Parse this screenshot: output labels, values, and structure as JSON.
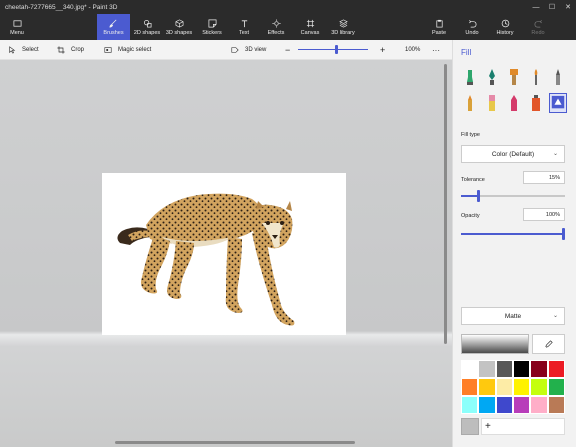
{
  "window": {
    "title": "cheetah-7277665__340.jpg* - Paint 3D",
    "minimize_glyph": "—",
    "maximize_glyph": "☐",
    "close_glyph": "✕"
  },
  "ribbon": {
    "menu": {
      "label": "Menu",
      "icon": "folder-icon"
    },
    "tools": [
      {
        "label": "Brushes",
        "icon": "brush-icon"
      },
      {
        "label": "2D shapes",
        "icon": "2d-shapes-icon"
      },
      {
        "label": "3D shapes",
        "icon": "3d-shapes-icon"
      },
      {
        "label": "Stickers",
        "icon": "stickers-icon"
      },
      {
        "label": "Text",
        "icon": "text-icon"
      },
      {
        "label": "Effects",
        "icon": "effects-icon"
      },
      {
        "label": "Canvas",
        "icon": "canvas-icon"
      },
      {
        "label": "3D library",
        "icon": "3d-library-icon"
      }
    ],
    "actions": [
      {
        "label": "Paste",
        "icon": "paste-icon"
      },
      {
        "label": "Undo",
        "icon": "undo-icon"
      },
      {
        "label": "History",
        "icon": "history-icon"
      },
      {
        "label": "Redo",
        "icon": "redo-icon"
      }
    ],
    "active_color": "#4b5bd0"
  },
  "toolbar": {
    "select": "Select",
    "crop": "Crop",
    "magic_select": "Magic select",
    "view_3d": "3D view",
    "zoom_out": "−",
    "zoom_in": "+",
    "zoom_value": "100%",
    "zoom_level": 0.53,
    "more": "···"
  },
  "panel": {
    "title": "Fill",
    "brushes": [
      "marker-icon",
      "calligraphy-pen-icon",
      "oil-brush-icon",
      "watercolor-icon",
      "pixel-pen-icon",
      "pencil-icon",
      "eraser-icon",
      "crayon-icon",
      "spray-can-icon",
      "fill-icon"
    ],
    "fill_type_label": "Fill type",
    "fill_type_value": "Color (Default)",
    "tolerance_label": "Tolerance",
    "tolerance_value": "15%",
    "tolerance_level": 0.15,
    "opacity_label": "Opacity",
    "opacity_value": "100%",
    "opacity_level": 1.0,
    "finish_value": "Matte",
    "add_color": "+",
    "current_color": "#bdbdbd",
    "palette": [
      "#ffffff",
      "#c3c3c3",
      "#585858",
      "#000000",
      "#88001b",
      "#ec1c24",
      "#ff7f27",
      "#ffc90e",
      "#fdeca6",
      "#fff200",
      "#c4ff0e",
      "#22b14c",
      "#8cfffb",
      "#00a8f3",
      "#3f48cc",
      "#b83dba",
      "#ffaec8",
      "#b97a56"
    ]
  }
}
